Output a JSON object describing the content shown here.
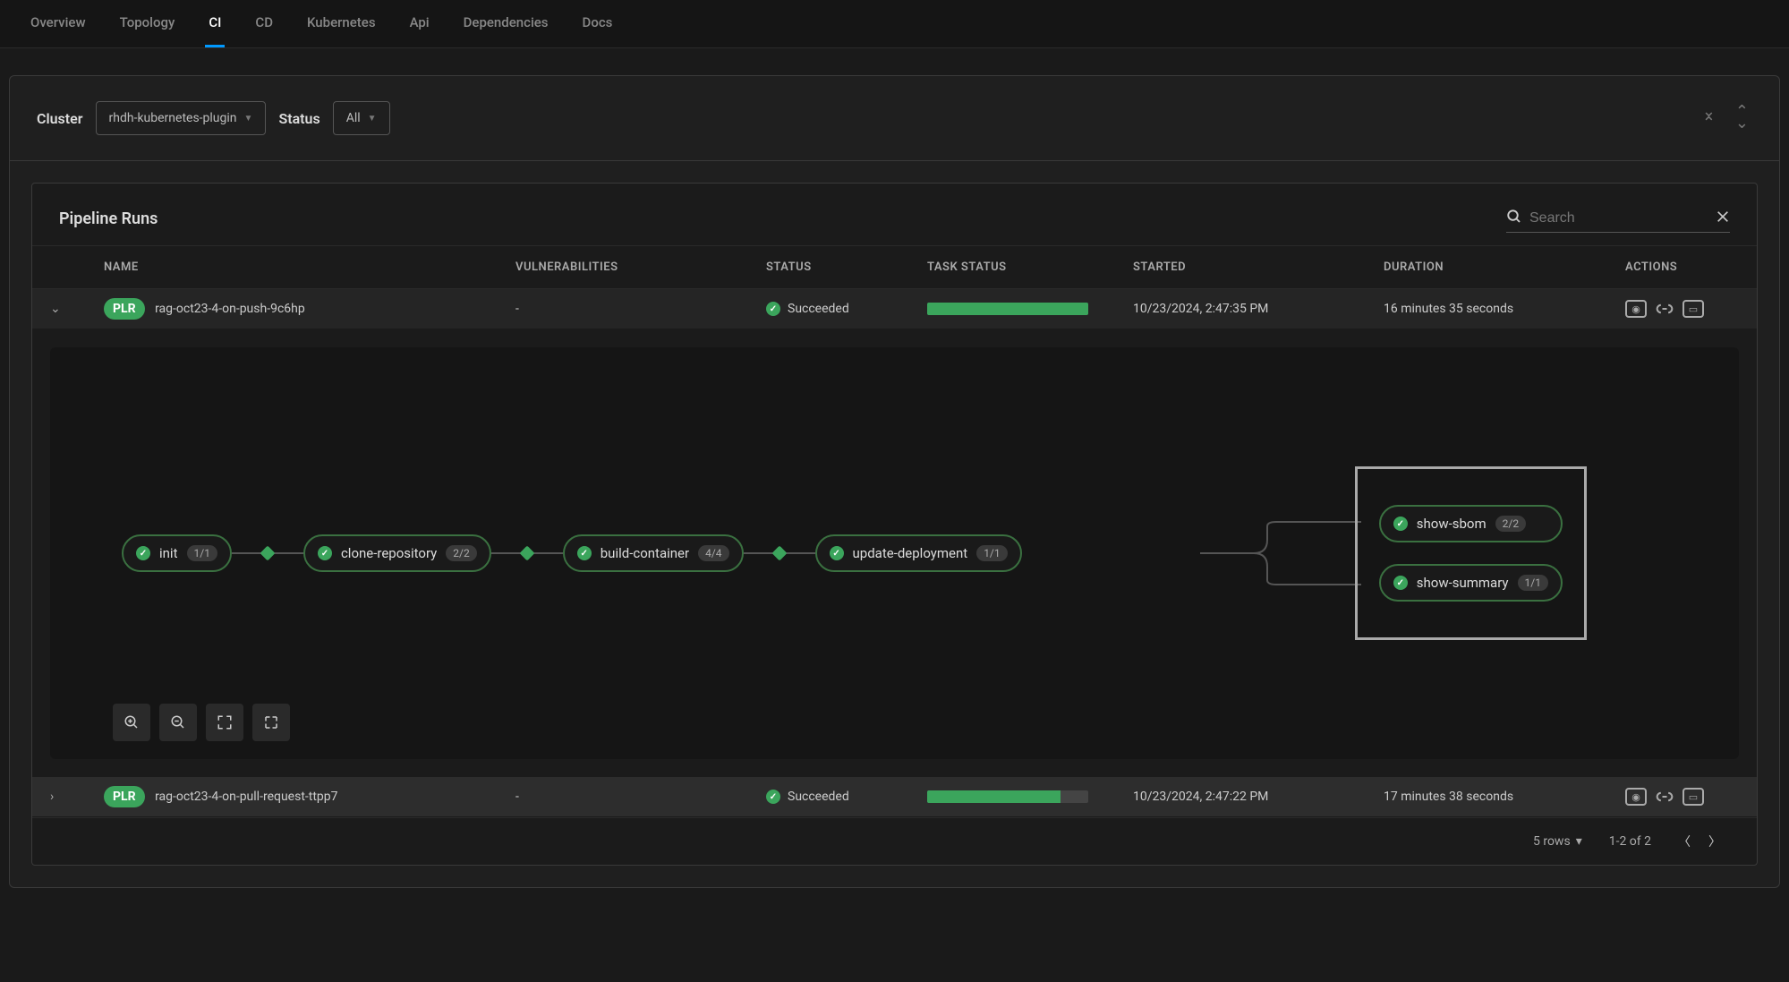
{
  "tabs": [
    "Overview",
    "Topology",
    "CI",
    "CD",
    "Kubernetes",
    "Api",
    "Dependencies",
    "Docs"
  ],
  "activeTab": "CI",
  "filters": {
    "clusterLabel": "Cluster",
    "clusterValue": "rhdh-kubernetes-plugin",
    "statusLabel": "Status",
    "statusValue": "All"
  },
  "panelTitle": "Pipeline Runs",
  "searchPlaceholder": "Search",
  "columns": [
    "",
    "NAME",
    "VULNERABILITIES",
    "STATUS",
    "TASK STATUS",
    "STARTED",
    "DURATION",
    "ACTIONS"
  ],
  "rows": [
    {
      "expanded": true,
      "badge": "PLR",
      "name": "rag-oct23-4-on-push-9c6hp",
      "vulnerabilities": "-",
      "status": "Succeeded",
      "taskProgress": 100,
      "started": "10/23/2024, 2:47:35 PM",
      "duration": "16 minutes 35 seconds"
    },
    {
      "expanded": false,
      "badge": "PLR",
      "name": "rag-oct23-4-on-pull-request-ttpp7",
      "vulnerabilities": "-",
      "status": "Succeeded",
      "taskProgress": 83,
      "started": "10/23/2024, 2:47:22 PM",
      "duration": "17 minutes 38 seconds"
    }
  ],
  "pipeline": {
    "linear": [
      {
        "name": "init",
        "count": "1/1"
      },
      {
        "name": "clone-repository",
        "count": "2/2"
      },
      {
        "name": "build-container",
        "count": "4/4"
      },
      {
        "name": "update-deployment",
        "count": "1/1"
      }
    ],
    "parallel": [
      {
        "name": "show-sbom",
        "count": "2/2"
      },
      {
        "name": "show-summary",
        "count": "1/1"
      }
    ]
  },
  "pagination": {
    "rowsLabel": "5 rows",
    "rangeLabel": "1-2 of 2"
  }
}
